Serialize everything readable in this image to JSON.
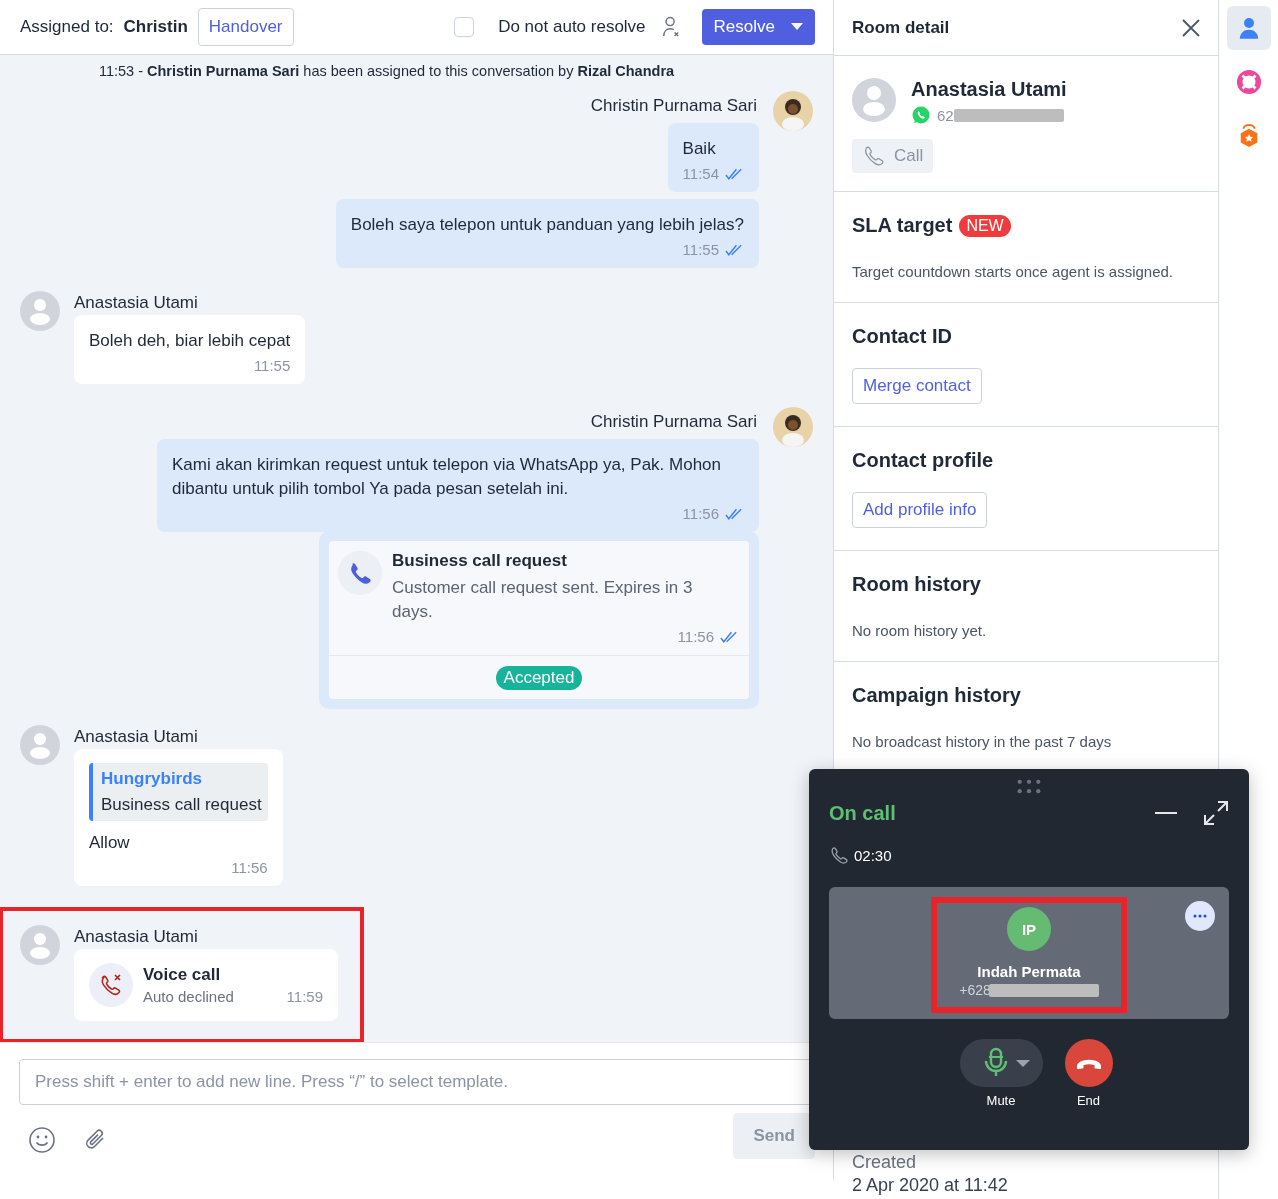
{
  "header": {
    "assigned_label": "Assigned to:",
    "assignee": "Christin",
    "handover": "Handover",
    "auto_resolve": {
      "label": "Do not auto resolve",
      "checked": false
    },
    "resolve": "Resolve"
  },
  "system_message": "11:53 - **Christin Purnama Sari** has been assigned to this conversation by **Rizal Chandra**",
  "groups": [
    {
      "kind": "agent",
      "sender": "Christin Purnama Sari",
      "messages": [
        {
          "kind": "text",
          "text": "Baik",
          "time": "11:54",
          "read": true
        },
        {
          "kind": "text",
          "text": "Boleh saya telepon untuk panduan yang lebih jelas?",
          "time": "11:55",
          "read": true
        }
      ]
    },
    {
      "kind": "customer",
      "sender": "Anastasia Utami",
      "messages": [
        {
          "kind": "text",
          "text": "Boleh deh, biar lebih cepat",
          "time": "11:55"
        }
      ]
    },
    {
      "kind": "agent",
      "sender": "Christin Purnama Sari",
      "messages": [
        {
          "kind": "text",
          "text": "Kami akan kirimkan request untuk telepon via WhatsApp ya, Pak. Mohon dibantu untuk pilih tombol Ya pada pesan setelah ini.",
          "time": "11:56",
          "read": true
        },
        {
          "kind": "call_request",
          "title": "Business call request",
          "text": "Customer call request sent. Expires in 3 days.",
          "time": "11:56",
          "read": true,
          "status": "Accepted"
        }
      ]
    },
    {
      "kind": "customer",
      "sender": "Anastasia Utami",
      "messages": [
        {
          "kind": "reply",
          "quote_author": "Hungrybirds",
          "quote_text": "Business call request",
          "text": "Allow",
          "time": "11:56"
        }
      ]
    },
    {
      "kind": "customer",
      "sender": "Anastasia Utami",
      "highlighted": true,
      "messages": [
        {
          "kind": "voice_call",
          "title": "Voice call",
          "text": "Auto declined",
          "time": "11:59"
        }
      ]
    }
  ],
  "composer": {
    "placeholder": "Press shift + enter to add new line. Press “/” to select template.",
    "send": "Send",
    "send_disabled": true
  },
  "panel": {
    "title": "Room detail",
    "contact": {
      "name": "Anastasia Utami",
      "phone_prefix": "62",
      "call": "Call",
      "call_disabled": true
    },
    "sections": [
      {
        "title": "SLA target",
        "badge": "NEW",
        "text": "Target countdown starts once agent is assigned."
      },
      {
        "title": "Contact ID",
        "button": "Merge contact"
      },
      {
        "title": "Contact profile",
        "button": "Add profile info"
      },
      {
        "title": "Room history",
        "text": "No room history yet."
      },
      {
        "title": "Campaign history",
        "text": "No broadcast history in the past 7 days"
      }
    ],
    "created_label": "Created",
    "created_value": "2 Apr 2020 at 11:42"
  },
  "rail": [
    {
      "kind": "contact",
      "selected": true
    },
    {
      "kind": "help",
      "selected": false
    },
    {
      "kind": "reward",
      "selected": false
    }
  ],
  "call": {
    "status": "On call",
    "duration": "02:30",
    "participant": {
      "initials": "IP",
      "name": "Indah Permata",
      "phone_prefix": "+628",
      "highlighted": true
    },
    "mute": "Mute",
    "end": "End"
  }
}
